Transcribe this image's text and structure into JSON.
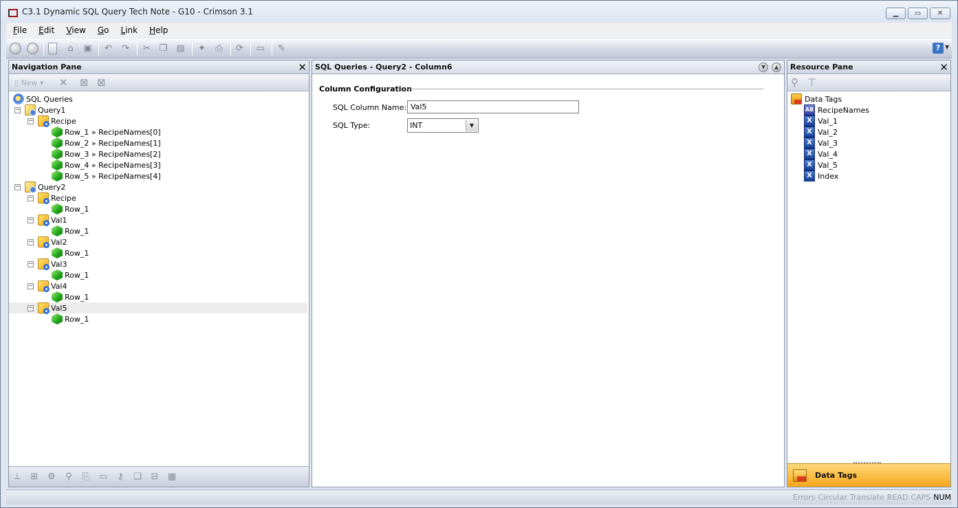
{
  "window": {
    "title": "C3.1 Dynamic SQL Query Tech Note - G10 - Crimson 3.1"
  },
  "menu": [
    {
      "first": "F",
      "rest": "ile"
    },
    {
      "first": "E",
      "rest": "dit"
    },
    {
      "first": "V",
      "rest": "iew"
    },
    {
      "first": "G",
      "rest": "o"
    },
    {
      "first": "L",
      "rest": "ink"
    },
    {
      "first": "H",
      "rest": "elp"
    }
  ],
  "toolbar": {
    "help_label": "?"
  },
  "nav_pane": {
    "title": "Navigation Pane",
    "new_label": "New",
    "tree": [
      {
        "label": "SQL Queries",
        "level": 0,
        "icon": "root",
        "expander": ""
      },
      {
        "label": "Query1",
        "level": 1,
        "icon": "query",
        "expander": "−"
      },
      {
        "label": "Recipe",
        "level": 2,
        "icon": "table",
        "expander": "−"
      },
      {
        "label": "Row_1 » RecipeNames[0]",
        "level": 3,
        "icon": "row",
        "expander": ""
      },
      {
        "label": "Row_2 » RecipeNames[1]",
        "level": 3,
        "icon": "row",
        "expander": ""
      },
      {
        "label": "Row_3 » RecipeNames[2]",
        "level": 3,
        "icon": "row",
        "expander": ""
      },
      {
        "label": "Row_4 » RecipeNames[3]",
        "level": 3,
        "icon": "row",
        "expander": ""
      },
      {
        "label": "Row_5 » RecipeNames[4]",
        "level": 3,
        "icon": "row",
        "expander": ""
      },
      {
        "label": "Query2",
        "level": 1,
        "icon": "query",
        "expander": "−"
      },
      {
        "label": "Recipe",
        "level": 2,
        "icon": "table",
        "expander": "−"
      },
      {
        "label": "Row_1",
        "level": 3,
        "icon": "row",
        "expander": ""
      },
      {
        "label": "Val1",
        "level": 2,
        "icon": "table",
        "expander": "−"
      },
      {
        "label": "Row_1",
        "level": 3,
        "icon": "row",
        "expander": ""
      },
      {
        "label": "Val2",
        "level": 2,
        "icon": "table",
        "expander": "−"
      },
      {
        "label": "Row_1",
        "level": 3,
        "icon": "row",
        "expander": ""
      },
      {
        "label": "Val3",
        "level": 2,
        "icon": "table",
        "expander": "−"
      },
      {
        "label": "Row_1",
        "level": 3,
        "icon": "row",
        "expander": ""
      },
      {
        "label": "Val4",
        "level": 2,
        "icon": "table",
        "expander": "−"
      },
      {
        "label": "Row_1",
        "level": 3,
        "icon": "row",
        "expander": ""
      },
      {
        "label": "Val5",
        "level": 2,
        "icon": "table",
        "expander": "−",
        "selected": true
      },
      {
        "label": "Row_1",
        "level": 3,
        "icon": "row",
        "expander": ""
      }
    ]
  },
  "editor": {
    "title": "SQL Queries - Query2 - Column6",
    "group_title": "Column Configuration",
    "column_name_label": "SQL Column Name:",
    "column_name_value": "Val5",
    "sql_type_label": "SQL Type:",
    "sql_type_value": "INT"
  },
  "resource_pane": {
    "title": "Resource Pane",
    "tree": [
      {
        "label": "Data Tags",
        "level": 0,
        "icon": "tags"
      },
      {
        "label": "RecipeNames",
        "level": 1,
        "icon": "text",
        "badge": "AB"
      },
      {
        "label": "Val_1",
        "level": 1,
        "icon": "num",
        "badge": "X"
      },
      {
        "label": "Val_2",
        "level": 1,
        "icon": "num",
        "badge": "X"
      },
      {
        "label": "Val_3",
        "level": 1,
        "icon": "num",
        "badge": "X"
      },
      {
        "label": "Val_4",
        "level": 1,
        "icon": "num",
        "badge": "X"
      },
      {
        "label": "Val_5",
        "level": 1,
        "icon": "num",
        "badge": "X"
      },
      {
        "label": "Index",
        "level": 1,
        "icon": "num",
        "badge": "X"
      }
    ],
    "tab_label": "Data Tags"
  },
  "statusbar": [
    {
      "label": "Errors",
      "active": false
    },
    {
      "label": "Circular",
      "active": false
    },
    {
      "label": "Translate",
      "active": false
    },
    {
      "label": "READ",
      "active": false
    },
    {
      "label": "CAPS",
      "active": false
    },
    {
      "label": "NUM",
      "active": true
    }
  ]
}
